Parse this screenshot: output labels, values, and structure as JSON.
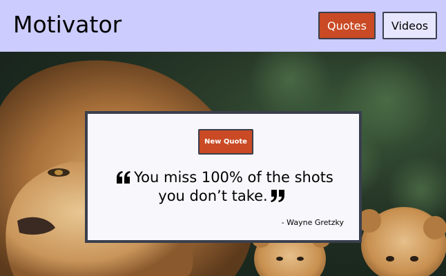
{
  "header": {
    "brand": "Motivator",
    "nav": [
      {
        "label": "Quotes"
      },
      {
        "label": "Videos"
      }
    ]
  },
  "hero": {
    "image_subject": "lion-with-cubs",
    "colors": {
      "accent": "#c94a24",
      "header_bg": "#ccccff",
      "card_bg": "#f8f8fc",
      "card_border": "#3a3f4e"
    }
  },
  "quote_card": {
    "button_label": "New Quote",
    "text": "You miss 100% of the shots you don’t take.",
    "author": "- Wayne Gretzky"
  }
}
